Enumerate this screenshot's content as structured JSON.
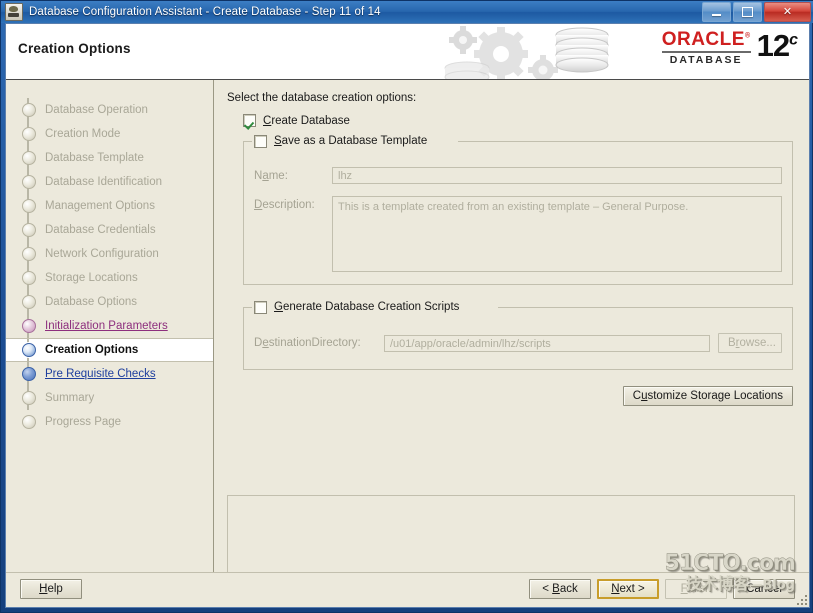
{
  "window": {
    "title": "Database Configuration Assistant - Create Database - Step 11 of 14",
    "app_icon": "oracle-dbca-icon",
    "minimize_label": "",
    "maximize_label": "",
    "close_label": "✕"
  },
  "banner": {
    "page_title": "Creation Options",
    "logo": {
      "brand": "ORACLE",
      "registered": "®",
      "product": "DATABASE",
      "version_number": "12",
      "version_suffix": "c"
    }
  },
  "sidebar": {
    "steps": [
      {
        "label": "Database Operation",
        "state": "done"
      },
      {
        "label": "Creation Mode",
        "state": "done"
      },
      {
        "label": "Database Template",
        "state": "done"
      },
      {
        "label": "Database Identification",
        "state": "done"
      },
      {
        "label": "Management Options",
        "state": "done"
      },
      {
        "label": "Database Credentials",
        "state": "done"
      },
      {
        "label": "Network Configuration",
        "state": "done"
      },
      {
        "label": "Storage Locations",
        "state": "done"
      },
      {
        "label": "Database Options",
        "state": "done"
      },
      {
        "label": "Initialization Parameters",
        "state": "visited"
      },
      {
        "label": "Creation Options",
        "state": "current"
      },
      {
        "label": "Pre Requisite Checks",
        "state": "next"
      },
      {
        "label": "Summary",
        "state": "future"
      },
      {
        "label": "Progress Page",
        "state": "future"
      }
    ]
  },
  "main": {
    "instruction": "Select the database creation options:",
    "create_database": {
      "label": "Create Database",
      "mnemonic": "C",
      "checked": true
    },
    "save_template": {
      "label": "Save as a Database Template",
      "mnemonic": "S",
      "checked": false,
      "name_label": "Name:",
      "name_mnemonic": "a",
      "name_value": "lhz",
      "description_label": "Description:",
      "description_mnemonic": "D",
      "description_value": "This is a template created from an existing template – General Purpose."
    },
    "generate_scripts": {
      "label": "Generate Database Creation Scripts",
      "mnemonic": "G",
      "checked": false,
      "destination_label": "DestinationDirectory:",
      "destination_mnemonic": "e",
      "destination_value": "/u01/app/oracle/admin/lhz/scripts",
      "browse_label": "Browse...",
      "browse_mnemonic": "r"
    },
    "customize_storage_label": "Customize Storage Locations",
    "customize_storage_mnemonic": "u",
    "message_panel_text": ""
  },
  "footer": {
    "help_label": "Help",
    "help_mnemonic": "H",
    "back_label": "< Back",
    "back_mnemonic": "B",
    "next_label": "Next >",
    "next_mnemonic": "N",
    "finish_label": "Finish",
    "finish_mnemonic": "F",
    "cancel_label": "Cancel"
  },
  "watermark": {
    "line1": "51CTO.com",
    "line2": "技术博客",
    "line2_suffix": "—Blog"
  },
  "colors": {
    "accent_blue": "#2766ad",
    "oracle_red": "#cf2020",
    "panel_bg": "#ece9dc",
    "visited_link": "#8d2f7e",
    "next_link": "#1f3f9e",
    "focus_gold": "#c89d2a"
  }
}
